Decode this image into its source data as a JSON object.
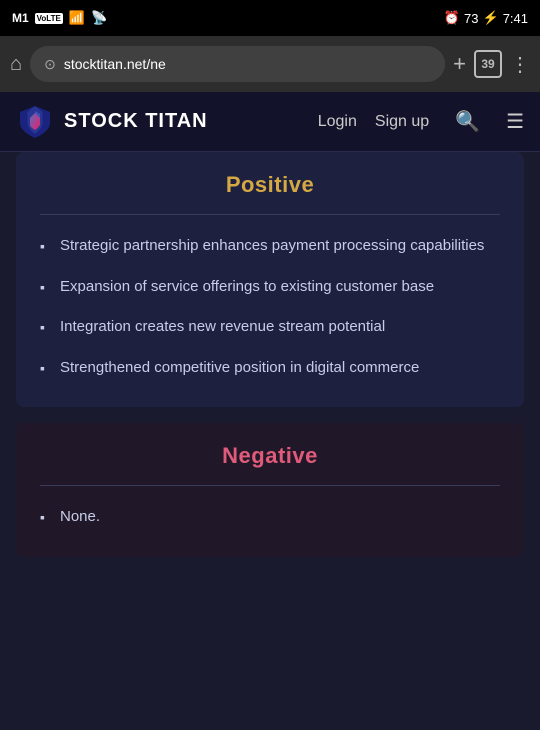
{
  "statusBar": {
    "carrier": "M1",
    "network": "VoLTE",
    "signal": "▂▄▆",
    "wifi": "wifi",
    "alarm": "⏰",
    "battery": "73",
    "time": "7:41"
  },
  "browser": {
    "url": "stocktitan.net/ne",
    "tabCount": "39",
    "addLabel": "+",
    "moreLabel": "⋮"
  },
  "nav": {
    "logoText": "STOCK TITAN",
    "loginLabel": "Login",
    "signupLabel": "Sign up"
  },
  "positive": {
    "title": "Positive",
    "items": [
      "Strategic partnership enhances payment processing capabilities",
      "Expansion of service offerings to existing customer base",
      "Integration creates new revenue stream potential",
      "Strengthened competitive position in digital commerce"
    ]
  },
  "negative": {
    "title": "Negative",
    "items": [
      "None."
    ]
  }
}
